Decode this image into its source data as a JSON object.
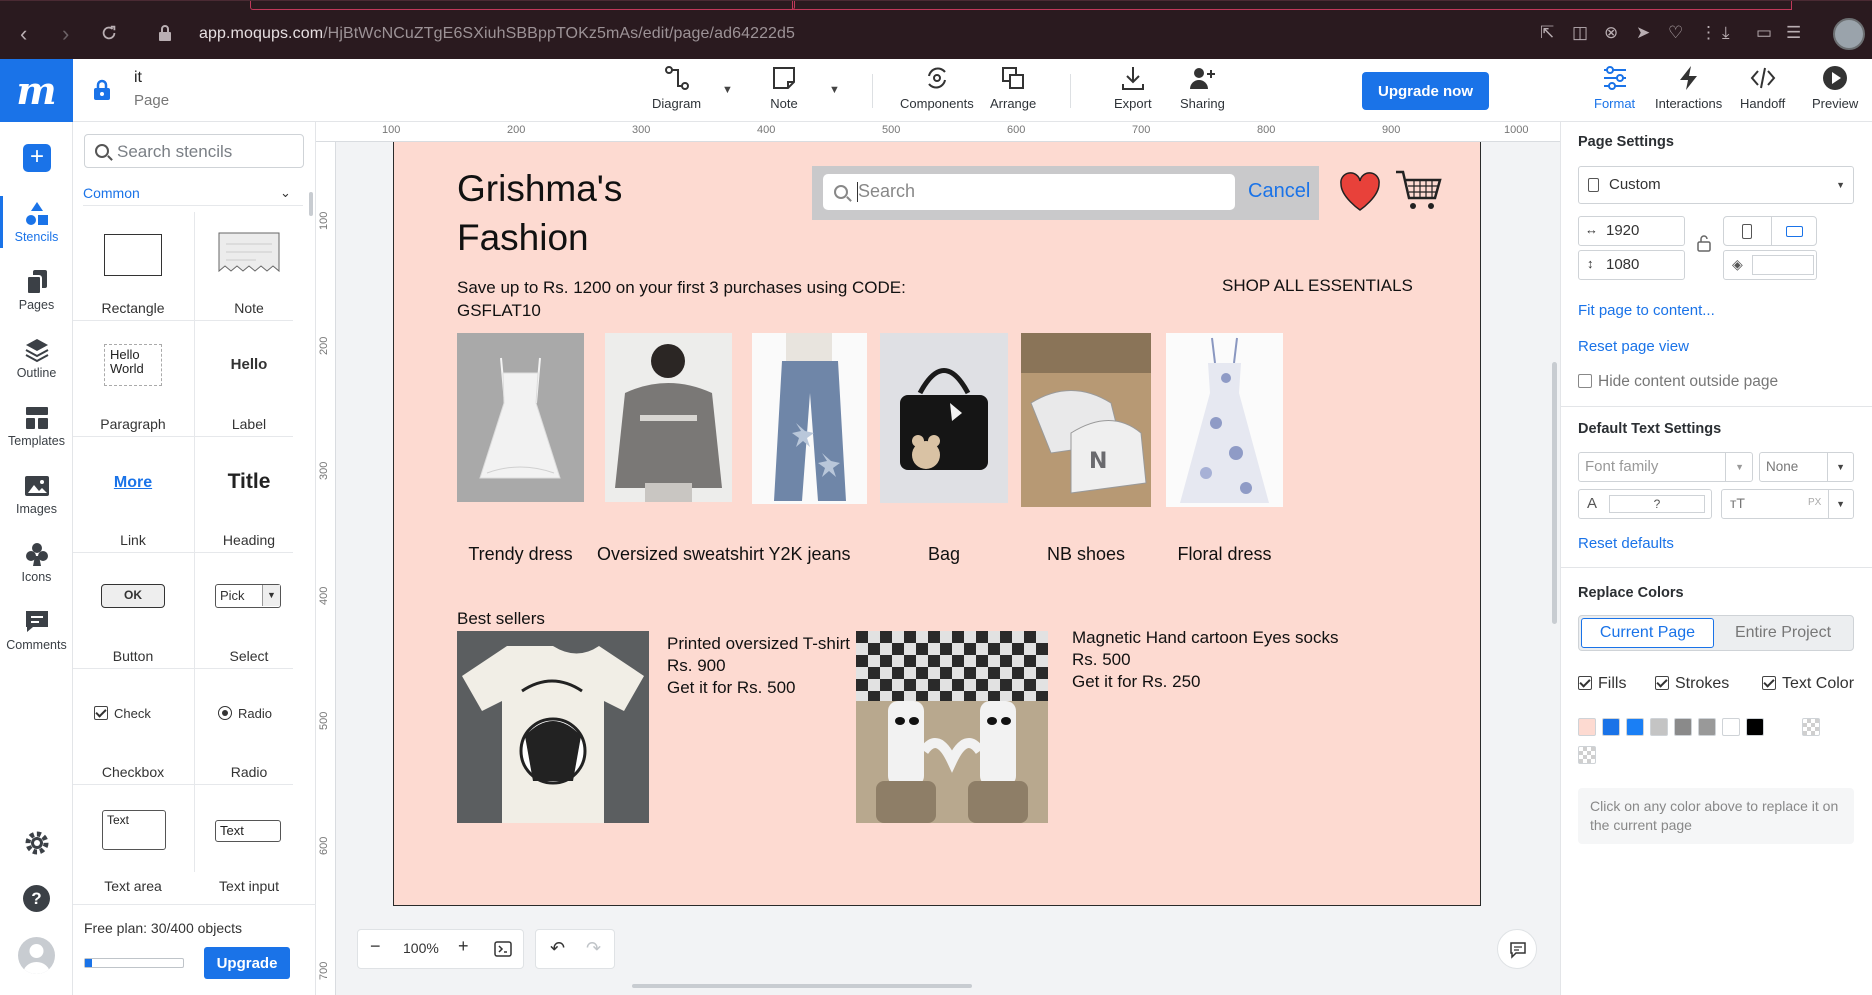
{
  "browser": {
    "url_host": "app.moqups.com",
    "url_path": "/HjBtWcNCuZTgE6SXiuhSBBppTOKz5mAs/edit/page/ad64222d5"
  },
  "header": {
    "logo": "m",
    "doc_name": "it",
    "doc_type": "Page",
    "tools": [
      "Diagram",
      "Note",
      "Components",
      "Arrange",
      "Export",
      "Sharing"
    ],
    "upgrade_label": "Upgrade now",
    "right_tools": [
      "Format",
      "Interactions",
      "Handoff",
      "Preview"
    ]
  },
  "rail": {
    "items": [
      "Stencils",
      "Pages",
      "Outline",
      "Templates",
      "Images",
      "Icons",
      "Comments"
    ],
    "help": "?"
  },
  "stencils": {
    "search_placeholder": "Search stencils",
    "category": "Common",
    "items": [
      {
        "label": "Rectangle"
      },
      {
        "label": "Note"
      },
      {
        "label": "Paragraph",
        "preview": "Hello World"
      },
      {
        "label": "Label",
        "preview": "Hello"
      },
      {
        "label": "Link",
        "preview": "More"
      },
      {
        "label": "Heading",
        "preview": "Title"
      },
      {
        "label": "Button",
        "preview": "OK"
      },
      {
        "label": "Select",
        "preview": "Pick"
      },
      {
        "label": "Checkbox",
        "preview": "Check"
      },
      {
        "label": "Radio",
        "preview": "Radio"
      },
      {
        "label": "Text area",
        "preview": "Text"
      },
      {
        "label": "Text input",
        "preview": "Text"
      }
    ],
    "plan_text": "Free plan: 30/400 objects",
    "plan_used": 30,
    "plan_total": 400,
    "upgrade_label": "Upgrade"
  },
  "canvas": {
    "ruler_h": [
      "100",
      "200",
      "300",
      "400",
      "500",
      "600",
      "700",
      "800",
      "900",
      "1000"
    ],
    "ruler_v": [
      "100",
      "200",
      "300",
      "400",
      "500",
      "600",
      "700"
    ],
    "zoom": "100%"
  },
  "page": {
    "brand": "Grishma's Fashion",
    "search_placeholder": "Search",
    "cancel_label": "Cancel",
    "promo": "Save up to Rs. 1200 on your first 3 purchases using CODE: GSFLAT10",
    "shop_all": "SHOP ALL ESSENTIALS",
    "products": [
      "Trendy dress",
      "Oversized sweatshirt",
      "Y2K jeans",
      "Bag",
      "NB shoes",
      "Floral dress"
    ],
    "best_sellers_label": "Best sellers",
    "best_sellers": [
      {
        "name": "Printed oversized T-shirt",
        "price": "Rs. 900",
        "offer": "Get it for Rs. 500"
      },
      {
        "name": "Magnetic Hand cartoon Eyes socks",
        "price": "Rs. 500",
        "offer": "Get it for Rs. 250"
      }
    ]
  },
  "format": {
    "page_settings": "Page Settings",
    "preset": "Custom",
    "width": "1920",
    "height": "1080",
    "fit_link": "Fit page to content...",
    "reset_view": "Reset page view",
    "hide_outside": "Hide content outside page",
    "text_settings": "Default Text Settings",
    "font_family": "Font family",
    "font_style": "None",
    "font_size_placeholder": "?",
    "px_unit": "PX",
    "reset_defaults": "Reset defaults",
    "replace_colors": "Replace Colors",
    "seg_current": "Current Page",
    "seg_entire": "Entire Project",
    "fills": "Fills",
    "strokes": "Strokes",
    "text_color": "Text Color",
    "swatches": [
      "#fddad1",
      "#1a73e8",
      "#1a7ff5",
      "#c4c4c4",
      "#8a8a8a",
      "#999999",
      "#ffffff",
      "#000000"
    ],
    "hint": "Click on any color above to replace it on the current page"
  }
}
